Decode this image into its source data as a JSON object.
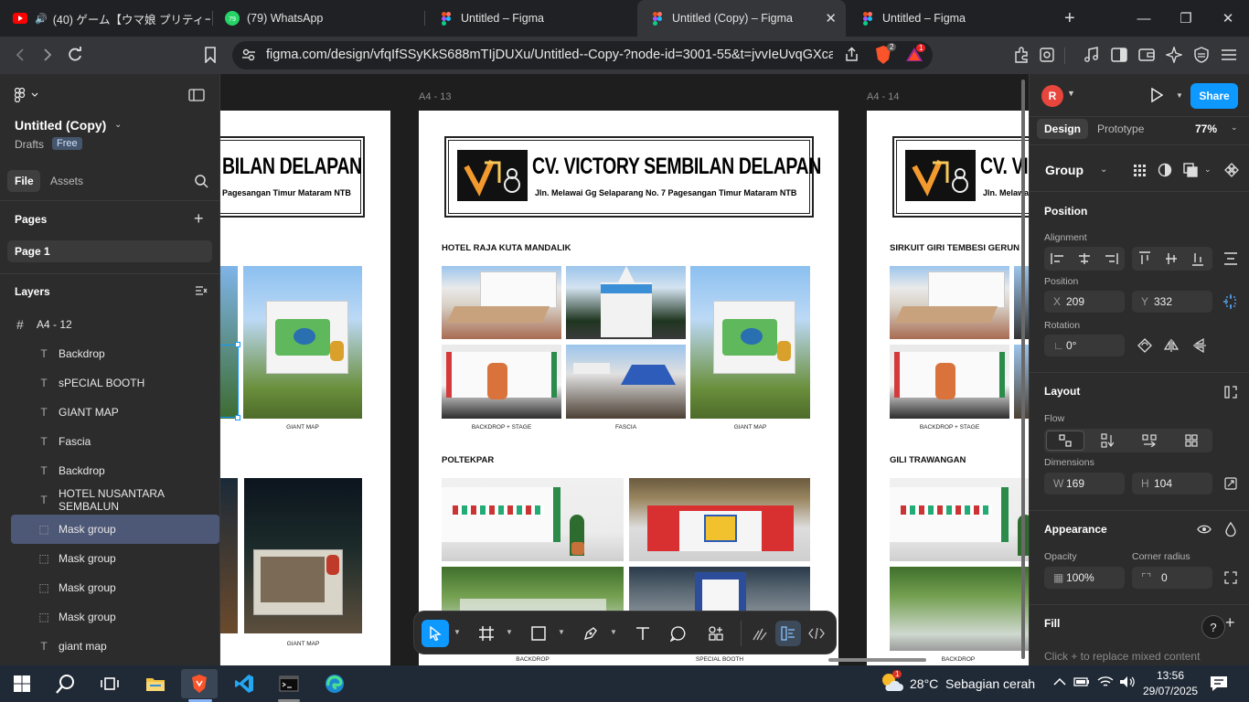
{
  "browser": {
    "tabs": [
      {
        "title": "(40) ゲーム【ウマ娘 プリティーダービ",
        "icon": "youtube-icon",
        "audio": true
      },
      {
        "title": "(79) WhatsApp",
        "icon": "whatsapp-icon",
        "badge": "79"
      },
      {
        "title": "Untitled – Figma",
        "icon": "figma-icon"
      },
      {
        "title": "Untitled (Copy) – Figma",
        "icon": "figma-icon",
        "active": true
      },
      {
        "title": "Untitled – Figma",
        "icon": "figma-icon"
      }
    ],
    "url": "figma.com/design/vfqIfSSyKkS688mTIjDUXu/Untitled--Copy-?node-id=3001-55&t=jvvIeUvqGXca...",
    "brave_badge": "2",
    "rewards_badge": "1"
  },
  "left_panel": {
    "file_name": "Untitled (Copy)",
    "location": "Drafts",
    "plan_badge": "Free",
    "tabs": {
      "file": "File",
      "assets": "Assets"
    },
    "pages_heading": "Pages",
    "pages": [
      "Page 1"
    ],
    "layers_heading": "Layers",
    "frame": "A4 - 12",
    "layers": [
      {
        "name": "Backdrop",
        "type": "text"
      },
      {
        "name": "sPECIAL BOOTH",
        "type": "text"
      },
      {
        "name": "GIANT MAP",
        "type": "text"
      },
      {
        "name": "Fascia",
        "type": "text"
      },
      {
        "name": "Backdrop",
        "type": "text"
      },
      {
        "name": "HOTEL NUSANTARA SEMBALUN",
        "type": "text"
      },
      {
        "name": "Mask group",
        "type": "mask",
        "selected": true
      },
      {
        "name": "Mask group",
        "type": "mask"
      },
      {
        "name": "Mask group",
        "type": "mask"
      },
      {
        "name": "Mask group",
        "type": "mask"
      },
      {
        "name": "giant map",
        "type": "text"
      }
    ]
  },
  "canvas": {
    "frames": [
      {
        "label": "",
        "header_title": "BILAN DELAPAN",
        "header_sub": "Pagesangan Timur Mataram NTB",
        "captions": [
          "GIANT MAP",
          "GIANT MAP"
        ]
      },
      {
        "label": "A4 - 13",
        "header_title": "CV. VICTORY SEMBILAN DELAPAN",
        "header_sub": "Jln. Melawai Gg Selaparang No. 7 Pagesangan Timur Mataram NTB",
        "section1": "HOTEL RAJA KUTA MANDALIK",
        "captions1": [
          "BACKDROP + STAGE",
          "FASCIA",
          "GIANT MAP"
        ],
        "section2": "POLTEKPAR",
        "captions2": [
          "BACKDROP",
          "SPECIAL BOOTH"
        ]
      },
      {
        "label": "A4 - 14",
        "header_title": "CV. VIC",
        "header_sub": "Jln. Melawa",
        "section1": "SIRKUIT GIRI TEMBESI GERUN",
        "captions1": [
          "BACKDROP + STAGE"
        ],
        "section2": "GILI TRAWANGAN",
        "captions2": [
          "BACKDROP"
        ]
      }
    ]
  },
  "right_panel": {
    "avatar_initial": "R",
    "share_label": "Share",
    "tabs": {
      "design": "Design",
      "prototype": "Prototype"
    },
    "zoom": "77%",
    "selection_type": "Group",
    "position_heading": "Position",
    "alignment_label": "Alignment",
    "position_label": "Position",
    "x_label": "X",
    "x_value": "209",
    "y_label": "Y",
    "y_value": "332",
    "rotation_label": "Rotation",
    "rotation_value": "0°",
    "layout_heading": "Layout",
    "flow_label": "Flow",
    "dimensions_label": "Dimensions",
    "w_label": "W",
    "w_value": "169",
    "h_label": "H",
    "h_value": "104",
    "appearance_heading": "Appearance",
    "opacity_label": "Opacity",
    "opacity_value": "100%",
    "corner_radius_label": "Corner radius",
    "corner_radius_value": "0",
    "fill_heading": "Fill",
    "fill_hint": "Click + to replace mixed content"
  },
  "taskbar": {
    "weather_temp": "28°C",
    "weather_text": "Sebagian cerah",
    "weather_badge": "1",
    "time": "13:56",
    "date": "29/07/2025"
  },
  "colors": {
    "figma_blue": "#0d99ff",
    "selection": "#4d5776",
    "brave_orange": "#fb542b"
  }
}
